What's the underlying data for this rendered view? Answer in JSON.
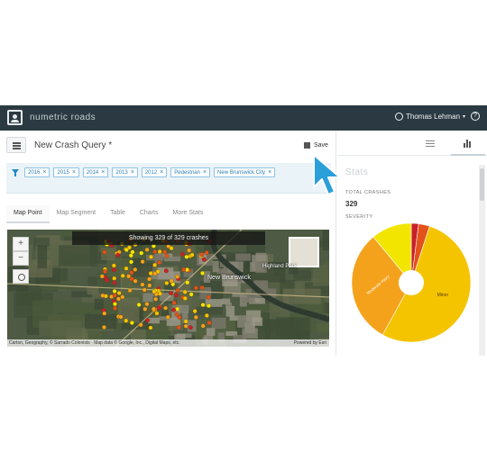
{
  "app": {
    "brand": "numetric roads",
    "user": "Thomas Lehman"
  },
  "query": {
    "title": "New Crash Query *",
    "save_label": "Save"
  },
  "filters": [
    {
      "label": "2016"
    },
    {
      "label": "2015"
    },
    {
      "label": "2014"
    },
    {
      "label": "2013"
    },
    {
      "label": "2012"
    },
    {
      "label": "Pedestrian"
    },
    {
      "label": "New Brunswick City"
    }
  ],
  "tabs": [
    {
      "label": "Map Point",
      "active": true
    },
    {
      "label": "Map Segment"
    },
    {
      "label": "Table"
    },
    {
      "label": "Charts"
    },
    {
      "label": "More Stats"
    }
  ],
  "map": {
    "banner": "Showing 329 of 329 crashes",
    "zoom_in": "+",
    "zoom_out": "−",
    "places": [
      "New Brunswick",
      "Highland Park"
    ],
    "attribution": "Carton, Geography, © Sarrado Colonists · Map data © Google, Inc., Digital Maps, etc.",
    "powered_by": "Powered by Esri"
  },
  "stats": {
    "title": "Stats",
    "total_label": "TOTAL CRASHES",
    "total_value": "329",
    "severity_label": "SEVERITY"
  },
  "chart_data": {
    "type": "pie",
    "title": "",
    "slices": [
      {
        "name": "Minor",
        "value": 53,
        "color": "#f5c400"
      },
      {
        "name": "Moderate Injury",
        "value": 31,
        "color": "#f4a21c"
      },
      {
        "name": "",
        "value": 11,
        "color": "#f2e600"
      },
      {
        "name": "",
        "value": 3,
        "color": "#e2521a"
      },
      {
        "name": "",
        "value": 2,
        "color": "#c9202a"
      }
    ],
    "labels": [
      "Minor",
      "Moderate Injury"
    ]
  },
  "colors": {
    "topbar": "#2b3a42",
    "accent": "#1e88c8",
    "cursor": "#2a9fd8"
  },
  "icons": [
    "user-icon",
    "help-icon",
    "menu-icon",
    "save-icon",
    "filter-icon",
    "close-icon",
    "sliders-icon",
    "bar-chart-icon",
    "locate-icon",
    "cursor-arrow-icon"
  ]
}
